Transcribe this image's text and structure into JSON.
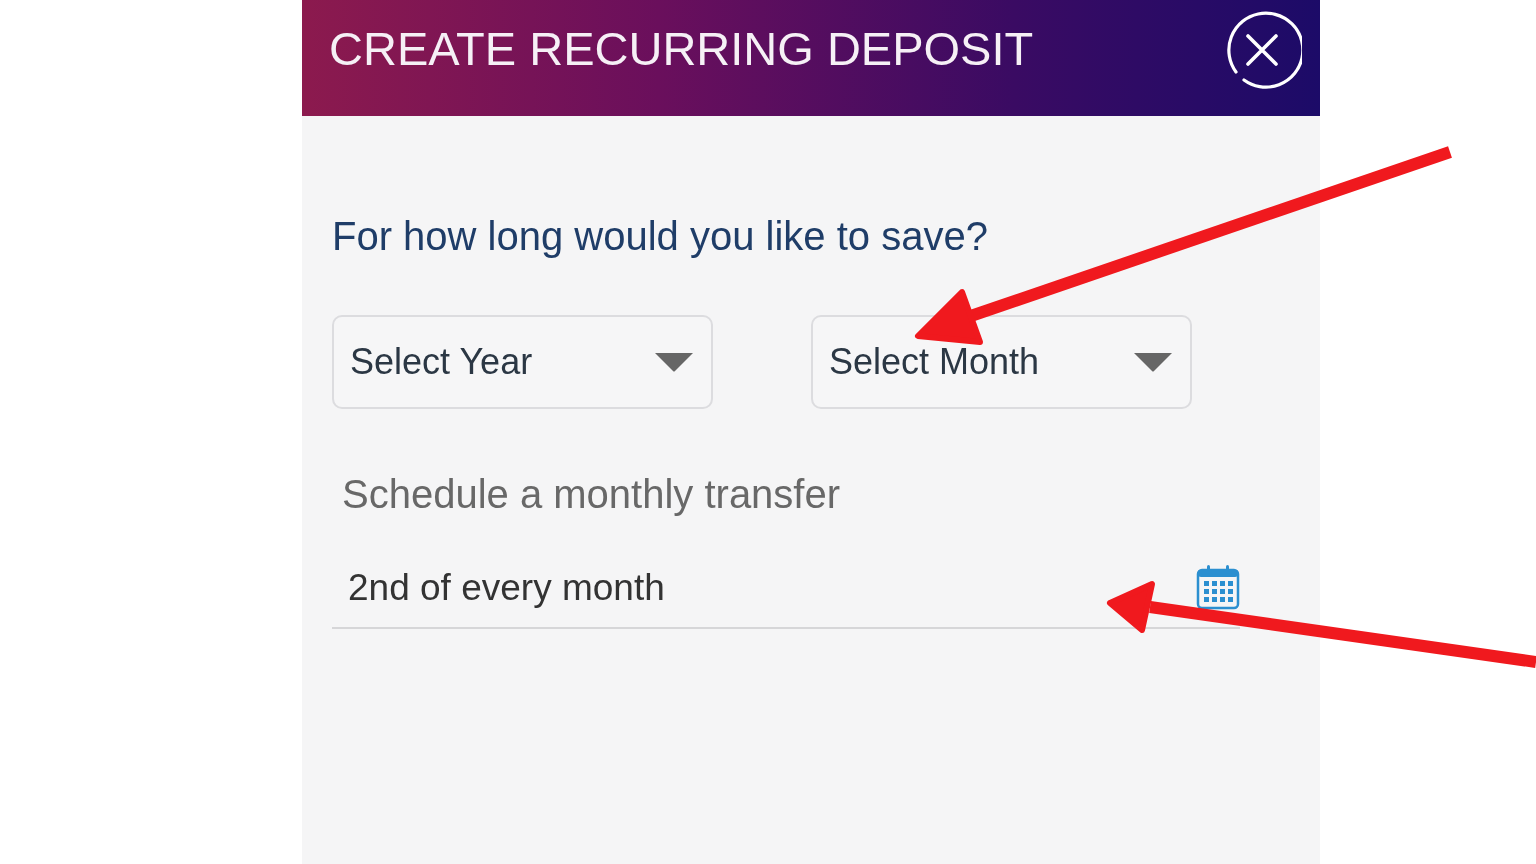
{
  "header": {
    "title": "CREATE RECURRING DEPOSIT"
  },
  "question": "For how long would you like to save?",
  "dropdowns": [
    {
      "placeholder": "Select Year"
    },
    {
      "placeholder": "Select Month"
    }
  ],
  "transfer": {
    "label": "Schedule a monthly transfer",
    "value": "2nd of every month"
  }
}
